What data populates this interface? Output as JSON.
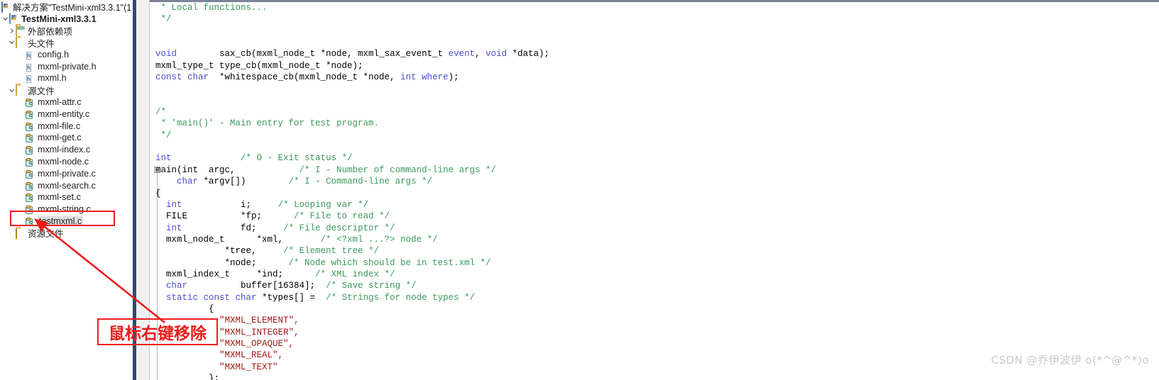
{
  "solution_explorer": {
    "header": {
      "icon": "solution-icon",
      "title": "解决方案\"TestMini-xml3.3.1\"(1 "
    },
    "tree": [
      {
        "label": "TestMini-xml3.3.1",
        "icon": "project-icon",
        "chevron": "expanded",
        "indent": 0,
        "kind": "project"
      },
      {
        "label": "外部依赖项",
        "icon": "folder-closed-icon",
        "chevron": "collapsed",
        "indent": 1,
        "kind": "folder"
      },
      {
        "label": "头文件",
        "icon": "folder-open-icon",
        "chevron": "expanded",
        "indent": 1,
        "kind": "folder"
      },
      {
        "label": "config.h",
        "icon": "header-file-icon",
        "chevron": "none",
        "indent": 2,
        "kind": "h"
      },
      {
        "label": "mxml-private.h",
        "icon": "header-file-icon",
        "chevron": "none",
        "indent": 2,
        "kind": "h"
      },
      {
        "label": "mxml.h",
        "icon": "header-file-icon",
        "chevron": "none",
        "indent": 2,
        "kind": "h"
      },
      {
        "label": "源文件",
        "icon": "folder-open-icon",
        "chevron": "expanded",
        "indent": 1,
        "kind": "folder"
      },
      {
        "label": "mxml-attr.c",
        "icon": "source-file-icon",
        "chevron": "none",
        "indent": 2,
        "kind": "c"
      },
      {
        "label": "mxml-entity.c",
        "icon": "source-file-icon",
        "chevron": "none",
        "indent": 2,
        "kind": "c"
      },
      {
        "label": "mxml-file.c",
        "icon": "source-file-icon",
        "chevron": "none",
        "indent": 2,
        "kind": "c"
      },
      {
        "label": "mxml-get.c",
        "icon": "source-file-icon",
        "chevron": "none",
        "indent": 2,
        "kind": "c"
      },
      {
        "label": "mxml-index.c",
        "icon": "source-file-icon",
        "chevron": "none",
        "indent": 2,
        "kind": "c"
      },
      {
        "label": "mxml-node.c",
        "icon": "source-file-icon",
        "chevron": "none",
        "indent": 2,
        "kind": "c"
      },
      {
        "label": "mxml-private.c",
        "icon": "source-file-icon",
        "chevron": "none",
        "indent": 2,
        "kind": "c"
      },
      {
        "label": "mxml-search.c",
        "icon": "source-file-icon",
        "chevron": "none",
        "indent": 2,
        "kind": "c"
      },
      {
        "label": "mxml-set.c",
        "icon": "source-file-icon",
        "chevron": "none",
        "indent": 2,
        "kind": "c"
      },
      {
        "label": "mxml-string.c",
        "icon": "source-file-icon",
        "chevron": "none",
        "indent": 2,
        "kind": "c"
      },
      {
        "label": "testmxml.c",
        "icon": "source-file-icon",
        "chevron": "none",
        "indent": 2,
        "kind": "c",
        "selected": true
      },
      {
        "label": "资源文件",
        "icon": "folder-resource-icon",
        "chevron": "none",
        "indent": 1,
        "kind": "folder"
      }
    ]
  },
  "annotation": {
    "note_text": "鼠标右键移除",
    "color": "#ee1c1c",
    "arrow": "red-arrow-to-testmxml"
  },
  "watermark": {
    "text": "CSDN @乔伊波伊 o(*^@^*)o",
    "color": "#c8c8c8"
  },
  "editor": {
    "fold_marker": "collapse-minus-box",
    "lines": [
      [
        {
          "t": " * Local functions...",
          "c": "cm"
        }
      ],
      [
        {
          "t": " */",
          "c": "cm"
        }
      ],
      [
        {
          "t": "",
          "c": "pl"
        }
      ],
      [
        {
          "t": "",
          "c": "pl"
        }
      ],
      [
        {
          "t": "void",
          "c": "kw"
        },
        {
          "t": "        sax_cb(mxml_node_t *node, mxml_sax_event_t ",
          "c": "pl"
        },
        {
          "t": "event",
          "c": "kw"
        },
        {
          "t": ", ",
          "c": "pl"
        },
        {
          "t": "void",
          "c": "kw"
        },
        {
          "t": " *data);",
          "c": "pl"
        }
      ],
      [
        {
          "t": "mxml_type_t type_cb(mxml_node_t *node);",
          "c": "pl"
        }
      ],
      [
        {
          "t": "const char",
          "c": "kw"
        },
        {
          "t": "  *whitespace_cb(mxml_node_t *node, ",
          "c": "pl"
        },
        {
          "t": "int where",
          "c": "kw"
        },
        {
          "t": ");",
          "c": "pl"
        }
      ],
      [
        {
          "t": "",
          "c": "pl"
        }
      ],
      [
        {
          "t": "",
          "c": "pl"
        }
      ],
      [
        {
          "t": "/*",
          "c": "cm"
        }
      ],
      [
        {
          "t": " * 'main()' - Main entry for test program.",
          "c": "cm"
        }
      ],
      [
        {
          "t": " */",
          "c": "cm"
        }
      ],
      [
        {
          "t": "",
          "c": "pl"
        }
      ],
      [
        {
          "t": "int",
          "c": "kw"
        },
        {
          "t": "             ",
          "c": "pl"
        },
        {
          "t": "/* O - Exit status */",
          "c": "cm"
        }
      ],
      [
        {
          "t": "main(int  argc,",
          "c": "pl"
        },
        {
          "t": "            ",
          "c": "pl"
        },
        {
          "t": "/* I - Number of command-line args */",
          "c": "cm"
        }
      ],
      [
        {
          "t": "    ",
          "c": "pl"
        },
        {
          "t": "char",
          "c": "kw"
        },
        {
          "t": " *argv[])",
          "c": "pl"
        },
        {
          "t": "        ",
          "c": "pl"
        },
        {
          "t": "/* I - Command-line args */",
          "c": "cm"
        }
      ],
      [
        {
          "t": "{",
          "c": "pl"
        }
      ],
      [
        {
          "t": "  ",
          "c": "pl"
        },
        {
          "t": "int",
          "c": "kw"
        },
        {
          "t": "           i;     ",
          "c": "pl"
        },
        {
          "t": "/* Looping var */",
          "c": "cm"
        }
      ],
      [
        {
          "t": "  FILE          *fp;      ",
          "c": "pl"
        },
        {
          "t": "/* File to read */",
          "c": "cm"
        }
      ],
      [
        {
          "t": "  ",
          "c": "pl"
        },
        {
          "t": "int",
          "c": "kw"
        },
        {
          "t": "           fd;     ",
          "c": "pl"
        },
        {
          "t": "/* File descriptor */",
          "c": "cm"
        }
      ],
      [
        {
          "t": "  mxml_node_t      *xml,       ",
          "c": "pl"
        },
        {
          "t": "/* <?xml ...?> node */",
          "c": "cm"
        }
      ],
      [
        {
          "t": "             *tree,     ",
          "c": "pl"
        },
        {
          "t": "/* Element tree */",
          "c": "cm"
        }
      ],
      [
        {
          "t": "             *node;      ",
          "c": "pl"
        },
        {
          "t": "/* Node which should be in test.xml */",
          "c": "cm"
        }
      ],
      [
        {
          "t": "  mxml_index_t     *ind;      ",
          "c": "pl"
        },
        {
          "t": "/* XML index */",
          "c": "cm"
        }
      ],
      [
        {
          "t": "  ",
          "c": "pl"
        },
        {
          "t": "char",
          "c": "kw"
        },
        {
          "t": "          buffer[16384];  ",
          "c": "pl"
        },
        {
          "t": "/* Save string */",
          "c": "cm"
        }
      ],
      [
        {
          "t": "  ",
          "c": "pl"
        },
        {
          "t": "static const char",
          "c": "kw"
        },
        {
          "t": " *types[] =  ",
          "c": "pl"
        },
        {
          "t": "/* Strings for node types */",
          "c": "cm"
        }
      ],
      [
        {
          "t": "          {",
          "c": "pl"
        }
      ],
      [
        {
          "t": "            \"MXML_ELEMENT\",",
          "c": "str"
        }
      ],
      [
        {
          "t": "            \"MXML_INTEGER\",",
          "c": "str"
        }
      ],
      [
        {
          "t": "            \"MXML_OPAQUE\",",
          "c": "str"
        }
      ],
      [
        {
          "t": "            \"MXML_REAL\",",
          "c": "str"
        }
      ],
      [
        {
          "t": "            \"MXML_TEXT\"",
          "c": "str"
        }
      ],
      [
        {
          "t": "          };",
          "c": "pl"
        }
      ]
    ]
  }
}
